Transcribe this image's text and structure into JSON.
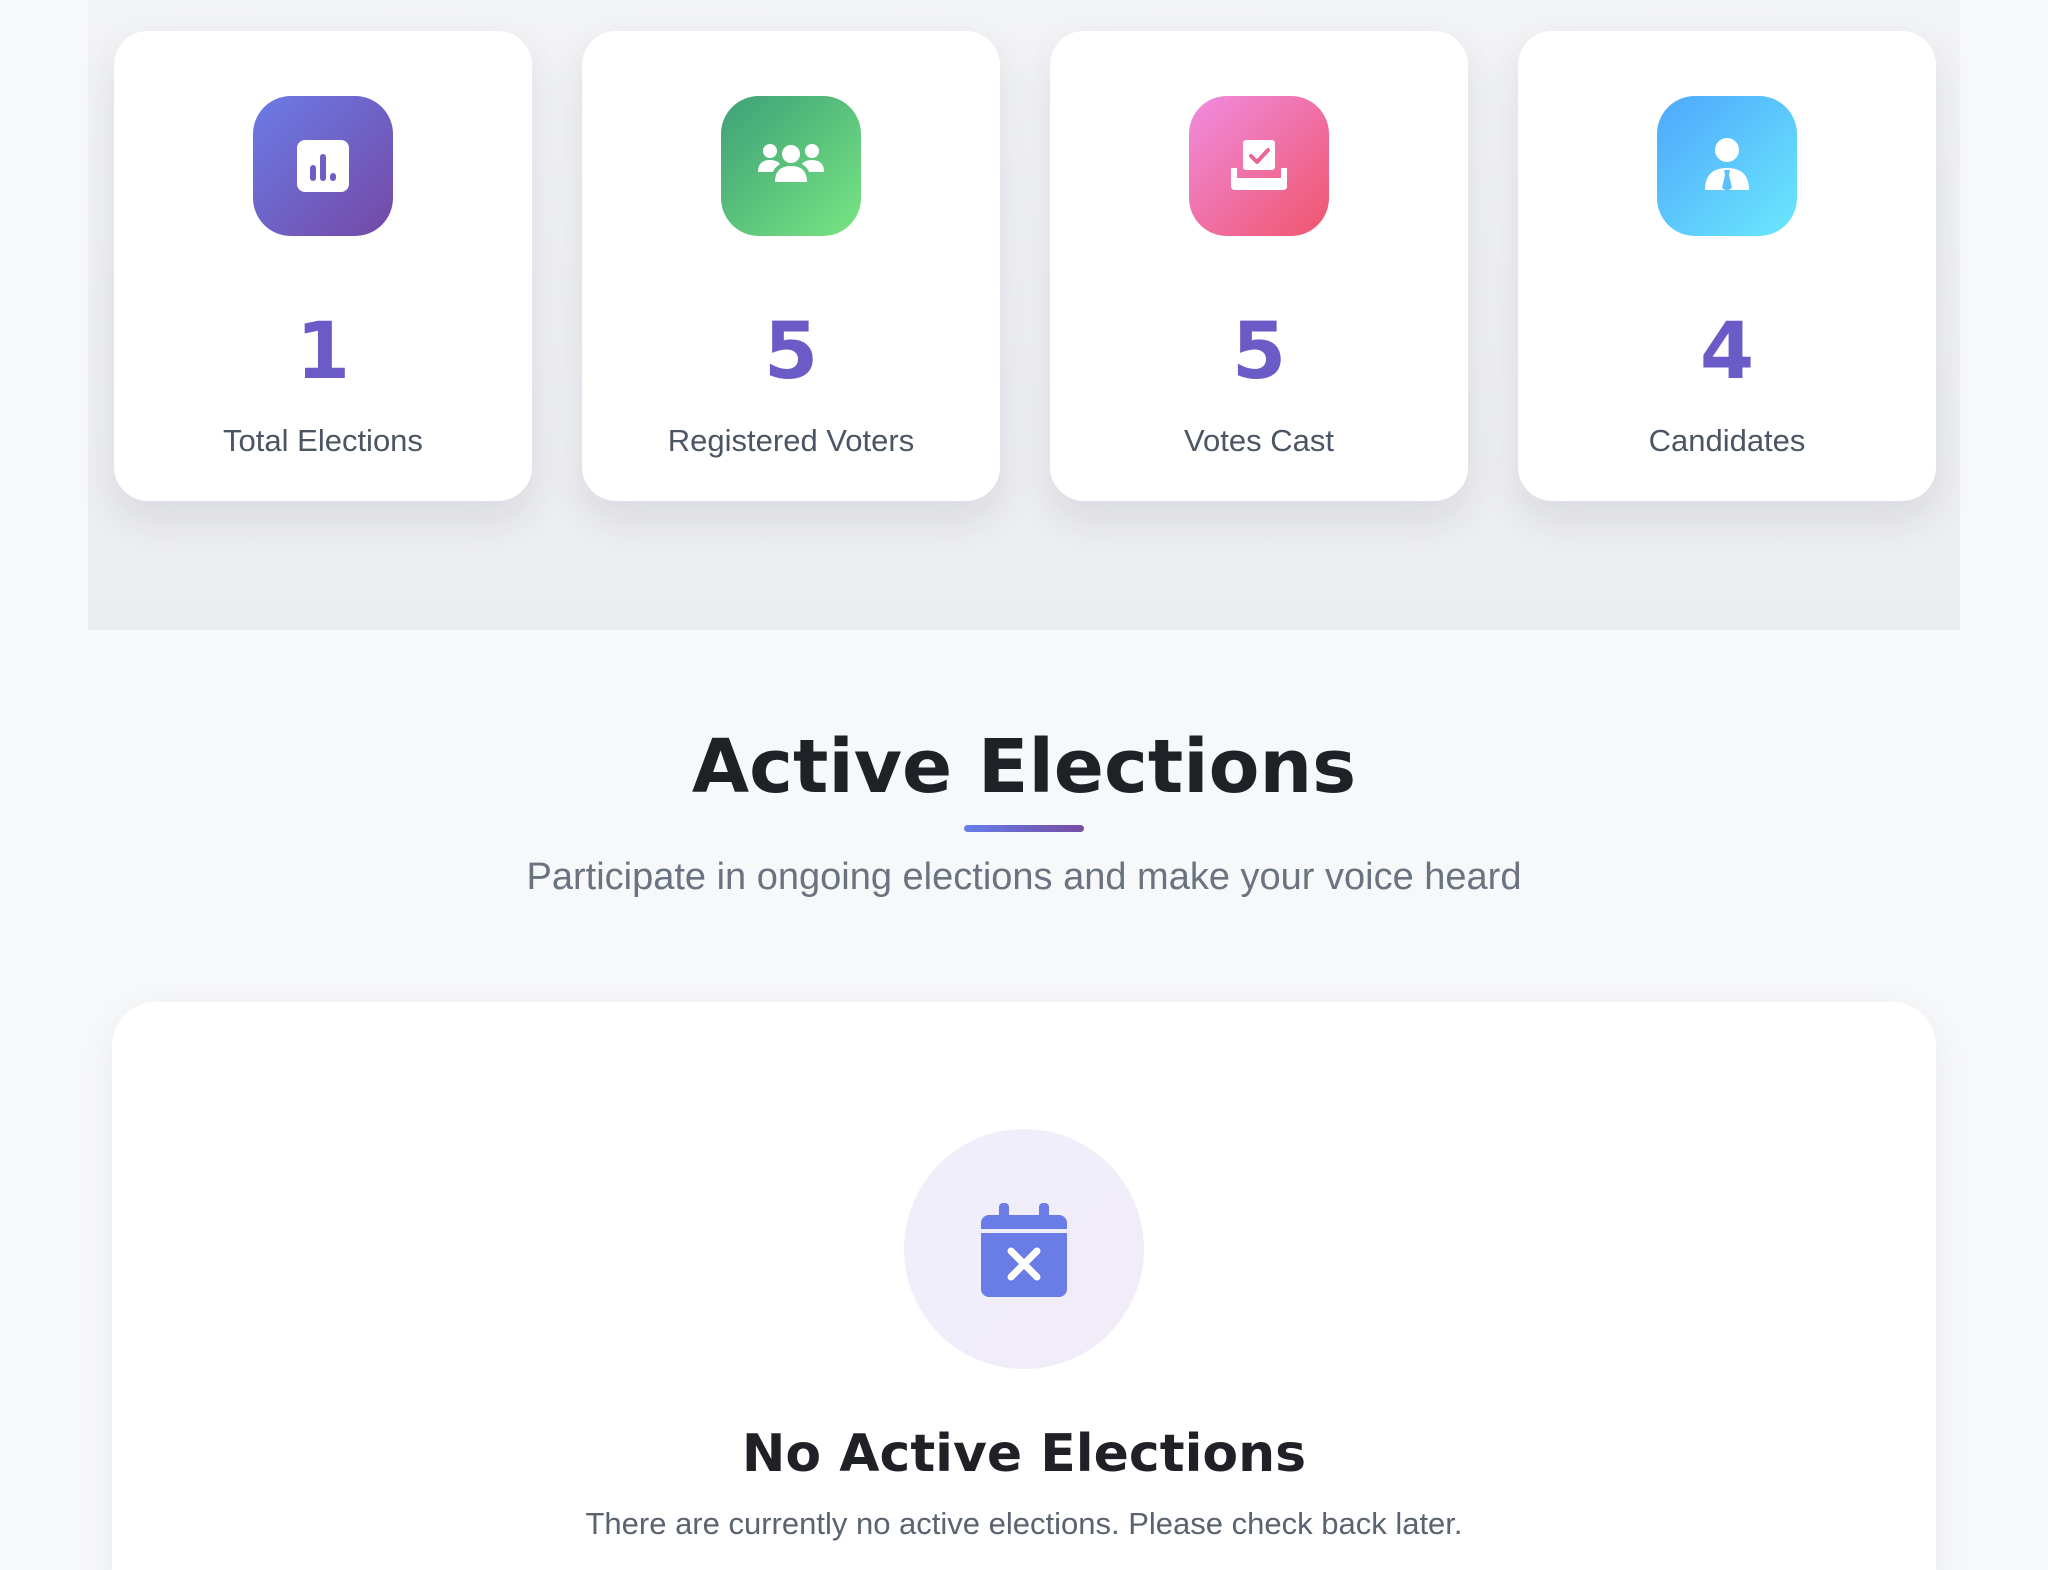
{
  "stats": [
    {
      "icon": "chart-icon",
      "value": "1",
      "label": "Total Elections",
      "gradient": [
        "#6a7ce6",
        "#7548a6"
      ]
    },
    {
      "icon": "users-icon",
      "value": "5",
      "label": "Registered Voters",
      "gradient": [
        "#3ea077",
        "#78e582"
      ]
    },
    {
      "icon": "vote-box-icon",
      "value": "5",
      "label": "Votes Cast",
      "gradient": [
        "#f08ce0",
        "#f0556c"
      ]
    },
    {
      "icon": "candidate-icon",
      "value": "4",
      "label": "Candidates",
      "gradient": [
        "#4ea7fc",
        "#6ae8fc"
      ]
    }
  ],
  "active_section": {
    "title": "Active Elections",
    "subtitle": "Participate in ongoing elections and make your voice heard"
  },
  "empty_state": {
    "icon": "calendar-x-icon",
    "title": "No Active Elections",
    "message": "There are currently no active elections. Please check back later."
  },
  "colors": {
    "accent": "#6a5bc7",
    "underline": [
      "#667eea",
      "#764ba2"
    ],
    "heading": "#1f2127"
  }
}
